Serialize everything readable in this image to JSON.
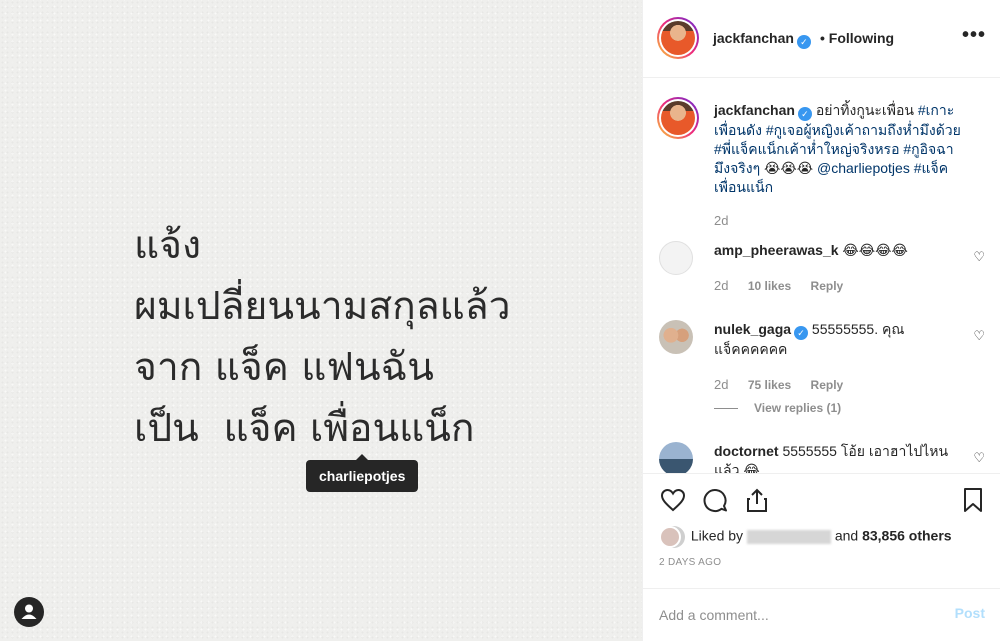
{
  "photo": {
    "lines": [
      "แจ้ง",
      "ผมเปลี่ยนนามสกุลแล้ว",
      "จาก แจ็ค แฟนฉัน",
      "เป็น  แจ็ค เพื่อนแน็ก"
    ],
    "tag_label": "charliepotjes"
  },
  "header": {
    "username": "jackfanchan",
    "follow_status": "• Following",
    "more": "•••"
  },
  "caption": {
    "username": "jackfanchan",
    "text_plain": "อย่าทิ้งกูนะเพื่อน ",
    "tags": [
      "#เกาะเพื่อนดัง",
      "#กูเจอผู้หญิงเค้าถามถึงห่ำมึงด้วย",
      "#พี่แจ็คแน็กเค้าห่ำใหญ่จริงหรอ",
      "#กูอิจฉามึงจริงๆ",
      "😭😭😭",
      "@charliepotjes",
      "#แจ็คเพื่อนแน็ก"
    ],
    "age": "2d"
  },
  "comments": [
    {
      "username": "amp_pheerawas_k",
      "text": "😂😂😂😂",
      "age": "2d",
      "likes": "10 likes",
      "reply": "Reply"
    },
    {
      "username": "nulek_gaga",
      "text": "55555555. คุณแจ็คคคคคค",
      "age": "2d",
      "likes": "75 likes",
      "reply": "Reply",
      "view_replies": "View replies (1)"
    },
    {
      "username": "doctornet",
      "text": "5555555 โอ้ย เอาฮาไปไหนแล้ว 😂"
    }
  ],
  "likes": {
    "prefix": "Liked by",
    "middle": "and",
    "count": "83,856 others",
    "time": "2 DAYS AGO"
  },
  "add_comment": {
    "placeholder": "Add a comment...",
    "post_label": "Post"
  },
  "colors": {
    "verified": "#3897f0",
    "hashtag": "#003569",
    "post_disabled": "#b2dffc"
  }
}
